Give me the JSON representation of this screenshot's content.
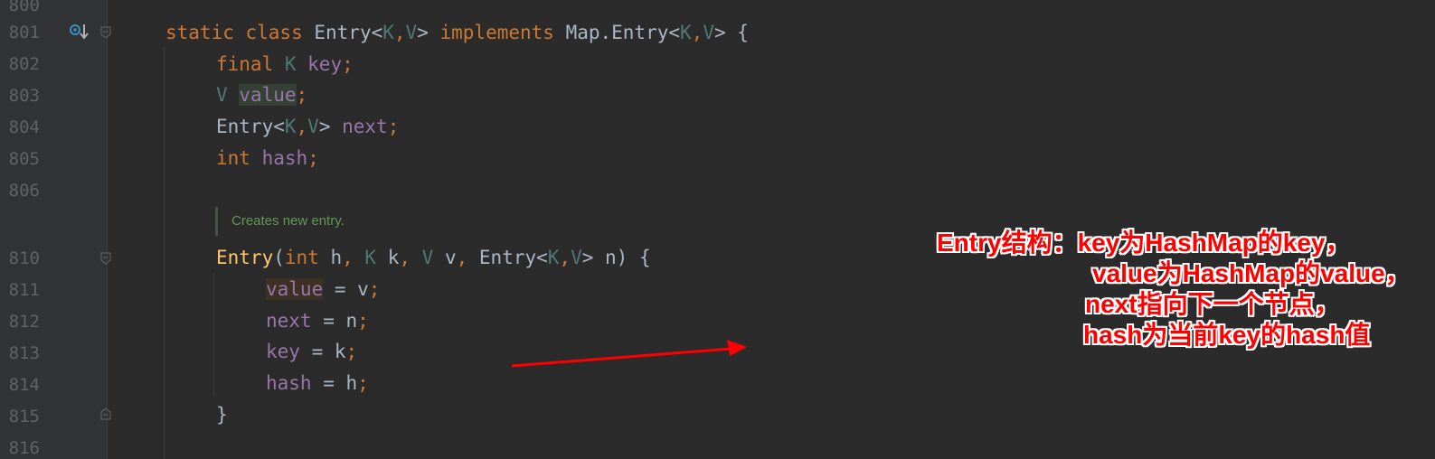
{
  "editor": {
    "lines": [
      {
        "no": "800",
        "tokens": []
      },
      {
        "no": "801",
        "tokens": [
          {
            "t": "static class ",
            "c": "kw"
          },
          {
            "t": "Entry<",
            "c": "pl"
          },
          {
            "t": "K",
            "c": "tp"
          },
          {
            "t": ",",
            "c": "kw"
          },
          {
            "t": "V",
            "c": "tp"
          },
          {
            "t": "> ",
            "c": "pl"
          },
          {
            "t": "implements ",
            "c": "kw"
          },
          {
            "t": "Map.Entry<",
            "c": "pl"
          },
          {
            "t": "K",
            "c": "tp"
          },
          {
            "t": ",",
            "c": "kw"
          },
          {
            "t": "V",
            "c": "tp"
          },
          {
            "t": "> {",
            "c": "pl"
          }
        ]
      },
      {
        "no": "802",
        "tokens": [
          {
            "t": "final ",
            "c": "kw"
          },
          {
            "t": "K ",
            "c": "tp"
          },
          {
            "t": "key",
            "c": "fld"
          },
          {
            "t": ";",
            "c": "kw"
          }
        ]
      },
      {
        "no": "803",
        "tokens": [
          {
            "t": "V ",
            "c": "tp"
          },
          {
            "t": "value",
            "c": "fld hl-value"
          },
          {
            "t": ";",
            "c": "kw"
          }
        ]
      },
      {
        "no": "804",
        "tokens": [
          {
            "t": "Entry<",
            "c": "pl"
          },
          {
            "t": "K",
            "c": "tp"
          },
          {
            "t": ",",
            "c": "kw"
          },
          {
            "t": "V",
            "c": "tp"
          },
          {
            "t": "> ",
            "c": "pl"
          },
          {
            "t": "next",
            "c": "fld"
          },
          {
            "t": ";",
            "c": "kw"
          }
        ]
      },
      {
        "no": "805",
        "tokens": [
          {
            "t": "int ",
            "c": "kw"
          },
          {
            "t": "hash",
            "c": "fld"
          },
          {
            "t": ";",
            "c": "kw"
          }
        ]
      },
      {
        "no": "806",
        "tokens": []
      },
      {
        "no": "810",
        "tokens": [
          {
            "t": "Entry",
            "c": "fn"
          },
          {
            "t": "(",
            "c": "pl"
          },
          {
            "t": "int ",
            "c": "kw"
          },
          {
            "t": "h",
            "c": "pl"
          },
          {
            "t": ", ",
            "c": "kw"
          },
          {
            "t": "K ",
            "c": "tp"
          },
          {
            "t": "k",
            "c": "pl"
          },
          {
            "t": ", ",
            "c": "kw"
          },
          {
            "t": "V ",
            "c": "tp"
          },
          {
            "t": "v",
            "c": "pl"
          },
          {
            "t": ", ",
            "c": "kw"
          },
          {
            "t": "Entry<",
            "c": "pl"
          },
          {
            "t": "K",
            "c": "tp"
          },
          {
            "t": ",",
            "c": "kw"
          },
          {
            "t": "V",
            "c": "tp"
          },
          {
            "t": "> n) {",
            "c": "pl"
          }
        ]
      },
      {
        "no": "811",
        "tokens": [
          {
            "t": "value",
            "c": "fld hl-value2"
          },
          {
            "t": " = v",
            "c": "pl"
          },
          {
            "t": ";",
            "c": "kw"
          }
        ]
      },
      {
        "no": "812",
        "tokens": [
          {
            "t": "next",
            "c": "fld"
          },
          {
            "t": " = n",
            "c": "pl"
          },
          {
            "t": ";",
            "c": "kw"
          }
        ]
      },
      {
        "no": "813",
        "tokens": [
          {
            "t": "key",
            "c": "fld"
          },
          {
            "t": " = k",
            "c": "pl"
          },
          {
            "t": ";",
            "c": "kw"
          }
        ]
      },
      {
        "no": "814",
        "tokens": [
          {
            "t": "hash",
            "c": "fld"
          },
          {
            "t": " = h",
            "c": "pl"
          },
          {
            "t": ";",
            "c": "kw"
          }
        ]
      },
      {
        "no": "815",
        "tokens": [
          {
            "t": "}",
            "c": "pl"
          }
        ]
      },
      {
        "no": "816",
        "tokens": []
      }
    ],
    "doc_comment": "Creates new entry."
  },
  "annotation": {
    "lines": [
      "Entry结构：key为HashMap的key，",
      "value为HashMap的value，",
      "next指向下一个节点，",
      "hash为当前key的hash值"
    ],
    "color": "#ff0000"
  },
  "icons": {
    "implements_gutter": "implementation-down-arrow-icon",
    "fold": "fold-marker-icon"
  }
}
